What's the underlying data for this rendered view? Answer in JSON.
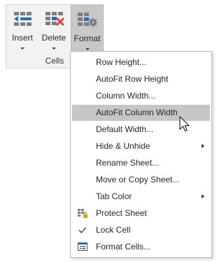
{
  "ribbon": {
    "insert_label": "Insert",
    "delete_label": "Delete",
    "format_label": "Format",
    "group_label": "Cells"
  },
  "menu": {
    "items": [
      {
        "label": "Row Height...",
        "has_submenu": false
      },
      {
        "label": "AutoFit Row Height",
        "has_submenu": false
      },
      {
        "label": "Column Width...",
        "has_submenu": false
      },
      {
        "label": "AutoFit Column Width",
        "has_submenu": false,
        "hovered": true
      },
      {
        "label": "Default Width...",
        "has_submenu": false
      },
      {
        "label": "Hide & Unhide",
        "has_submenu": true
      },
      {
        "label": "Rename Sheet...",
        "has_submenu": false
      },
      {
        "label": "Move or Copy Sheet...",
        "has_submenu": false
      },
      {
        "label": "Tab Color",
        "has_submenu": true
      },
      {
        "label": "Protect Sheet",
        "icon": "protect-sheet-icon"
      },
      {
        "label": "Lock Cell",
        "icon": "checkmark-icon"
      },
      {
        "label": "Format Cells...",
        "icon": "format-cells-icon"
      }
    ]
  },
  "colors": {
    "ribbon_bg": "#f2f2f2",
    "format_pressed": "#c8c8c8",
    "menu_hover": "#c6c6c6",
    "accent_blue": "#2b6cb5",
    "delete_red": "#e0483f",
    "lock_gold": "#d6a21e"
  }
}
